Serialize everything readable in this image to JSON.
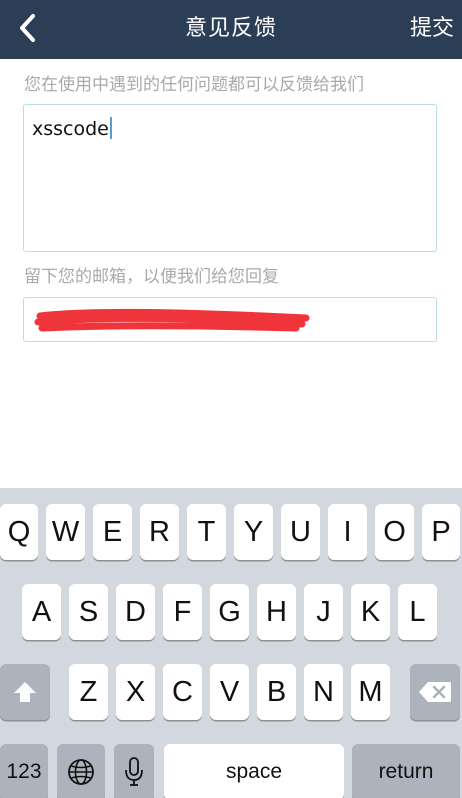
{
  "nav": {
    "title": "意见反馈",
    "submit_label": "提交"
  },
  "form": {
    "feedback_hint": "您在使用中遇到的任何问题都可以反馈给我们",
    "feedback_value": "xsscode",
    "email_hint": "留下您的邮箱，以便我们给您回复"
  },
  "keyboard": {
    "row1": [
      "Q",
      "W",
      "E",
      "R",
      "T",
      "Y",
      "U",
      "I",
      "O",
      "P"
    ],
    "row2": [
      "A",
      "S",
      "D",
      "F",
      "G",
      "H",
      "J",
      "K",
      "L"
    ],
    "row3": [
      "Z",
      "X",
      "C",
      "V",
      "B",
      "N",
      "M"
    ],
    "numbers_label": "123",
    "space_label": "space",
    "return_label": "return"
  },
  "colors": {
    "nav_background": "#2b3e55",
    "input_border": "#b7dde6",
    "redaction": "#f0353a",
    "keyboard_background": "#d3d7de"
  }
}
